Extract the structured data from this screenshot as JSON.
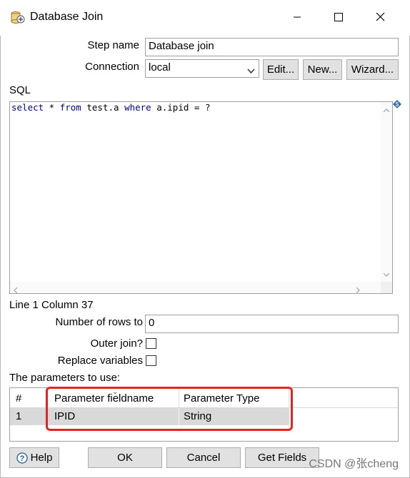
{
  "window": {
    "title": "Database Join",
    "minimize_glyph": "—",
    "maximize_glyph": "☐",
    "close_glyph": "✕"
  },
  "form": {
    "step_name_label": "Step name",
    "step_name_value": "Database join",
    "connection_label": "Connection",
    "connection_value": "local",
    "edit_button": "Edit...",
    "new_button": "New...",
    "wizard_button": "Wizard..."
  },
  "sql": {
    "label": "SQL",
    "tokens": [
      {
        "text": "select",
        "kind": "keyword"
      },
      {
        "text": " * ",
        "kind": "plain"
      },
      {
        "text": "from",
        "kind": "keyword"
      },
      {
        "text": " test.a ",
        "kind": "plain"
      },
      {
        "text": "where",
        "kind": "keyword"
      },
      {
        "text": " a.ipid = ?",
        "kind": "plain"
      }
    ],
    "cursor_position": "Line 1 Column 37"
  },
  "options": {
    "rows_label": "Number of rows to",
    "rows_value": "0",
    "outer_join_label": "Outer join?",
    "outer_join_checked": false,
    "replace_vars_label": "Replace variables",
    "replace_vars_checked": false
  },
  "parameters": {
    "label": "The parameters to use:",
    "columns": [
      "#",
      "Parameter fieldname",
      "Parameter Type"
    ],
    "rows": [
      {
        "num": "1",
        "fieldname": "IPID",
        "type": "String"
      }
    ]
  },
  "buttons": {
    "help": "Help",
    "ok": "OK",
    "cancel": "Cancel",
    "get_fields": "Get Fields"
  },
  "watermark": "CSDN @张cheng",
  "colors": {
    "keyword": "#00008b",
    "highlight": "#e8231f",
    "row_selected": "#d9d9d9"
  }
}
